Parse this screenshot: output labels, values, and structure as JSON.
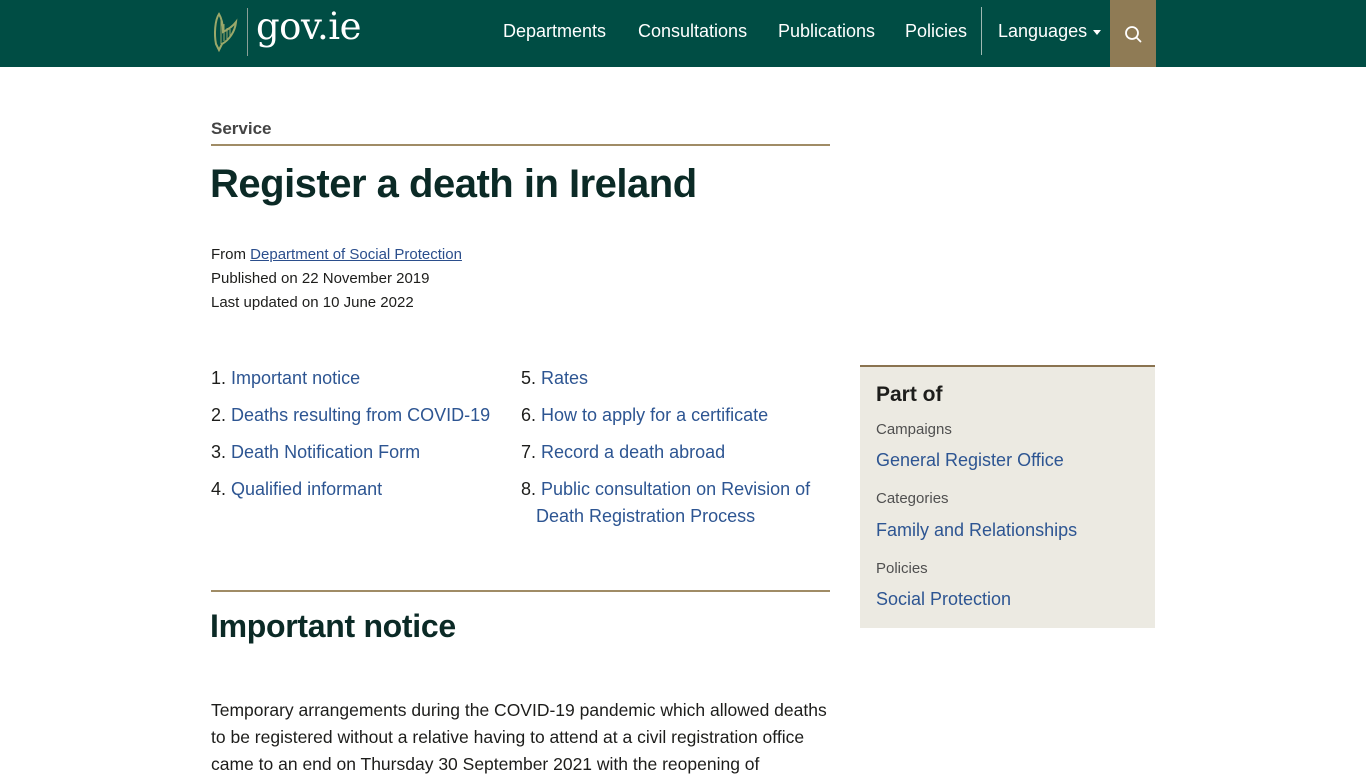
{
  "header": {
    "logo_text": "gov.ie",
    "nav": [
      "Departments",
      "Consultations",
      "Publications",
      "Policies"
    ],
    "languages_label": "Languages",
    "colors": {
      "bar": "#004d44",
      "search": "#8f7b55"
    }
  },
  "page": {
    "type_label": "Service",
    "title": "Register a death in Ireland",
    "from_label": "From",
    "department": "Department of Social Protection",
    "published": "Published on 22 November 2019",
    "updated": "Last updated on 10 June 2022"
  },
  "toc": [
    {
      "num": "1.",
      "label": "Important notice"
    },
    {
      "num": "2.",
      "label": "Deaths resulting from COVID-19"
    },
    {
      "num": "3.",
      "label": "Death Notification Form"
    },
    {
      "num": "4.",
      "label": "Qualified informant"
    },
    {
      "num": "5.",
      "label": "Rates"
    },
    {
      "num": "6.",
      "label": "How to apply for a certificate"
    },
    {
      "num": "7.",
      "label": "Record a death abroad"
    },
    {
      "num": "8.",
      "label": "Public consultation on Revision of",
      "label_line2": "Death Registration Process"
    }
  ],
  "section": {
    "heading": "Important notice",
    "body": "Temporary arrangements during the COVID-19 pandemic which allowed deaths to be registered without a relative having to attend at a civil registration office came to an end on Thursday 30 September 2021 with the reopening of"
  },
  "part_of": {
    "title": "Part of",
    "groups": [
      {
        "label": "Campaigns",
        "link": "General Register Office"
      },
      {
        "label": "Categories",
        "link": "Family and Relationships"
      },
      {
        "label": "Policies",
        "link": "Social Protection"
      }
    ]
  }
}
